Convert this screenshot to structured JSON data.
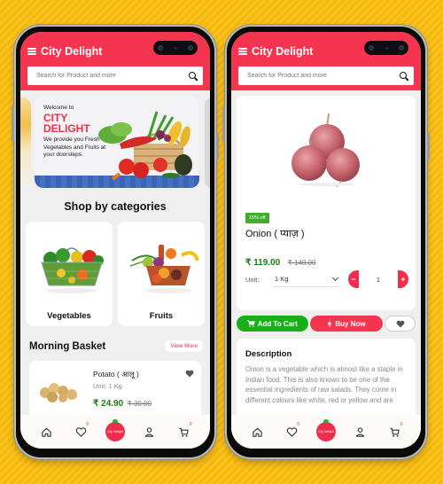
{
  "app": {
    "title": "City Delight"
  },
  "search": {
    "placeholder": "Search for Product and more"
  },
  "home": {
    "banner": {
      "welcome": "Welcome to",
      "brand": "CITY DELIGHT",
      "description": "We provide you Fresh Vegetables and Fruits at your doorsteps."
    },
    "categories_title": "Shop by categories",
    "categories": [
      {
        "label": "Vegetables"
      },
      {
        "label": "Fruits"
      }
    ],
    "morning_basket": {
      "title": "Morning Basket",
      "view_more": "View More",
      "products": [
        {
          "name": "Potato ( आलू )",
          "unit": "Unit: 1 Kg",
          "price": "₹ 24.90",
          "old_price": "₹ 30.00"
        }
      ]
    }
  },
  "detail": {
    "discount_badge": "15% off",
    "name": "Onion ( प्याज़ )",
    "price": "₹ 119.00",
    "old_price": "₹ 140.00",
    "unit_label": "Unit:",
    "unit_selected": "1 Kg",
    "quantity": "1",
    "minus": "−",
    "plus": "+",
    "add_to_cart": "Add To Cart",
    "buy_now": "Buy Now",
    "description_title": "Description",
    "description": "Onion is a vegetable which is almost like a staple in Indian food. This is also known to be one of the essential ingredients of raw salads. They come in different colours like white, red or yellow and are"
  },
  "bottom_nav": {
    "wishlist_count": "0",
    "cart_count": "0",
    "logo_text": "City Delight"
  },
  "colors": {
    "primary": "#f5344f",
    "green_button": "#18b018",
    "price_green": "#1e7a16",
    "badge_green": "#3fae2a",
    "background_yellow": "#f9c21c"
  }
}
